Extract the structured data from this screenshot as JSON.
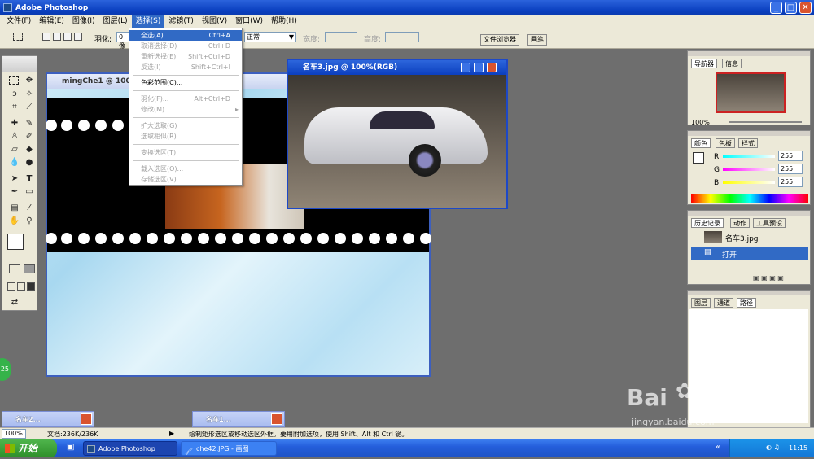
{
  "app": {
    "title": "Adobe Photoshop"
  },
  "menubar": [
    "文件(F)",
    "编辑(E)",
    "图像(I)",
    "图层(L)",
    "选择(S)",
    "滤镜(T)",
    "视图(V)",
    "窗口(W)",
    "帮助(H)"
  ],
  "options": {
    "feather_label": "羽化:",
    "feather_value": "0 像",
    "style_value": "正常",
    "width_label": "宽度:",
    "height_label": "高度:",
    "tab_file_browser": "文件浏览器",
    "tab_brushes": "画笔"
  },
  "select_menu": {
    "items": [
      {
        "label": "全选(A)",
        "shortcut": "Ctrl+A"
      },
      {
        "label": "取消选择(D)",
        "shortcut": "Ctrl+D"
      },
      {
        "label": "重新选择(E)",
        "shortcut": "Shift+Ctrl+D"
      },
      {
        "label": "反选(I)",
        "shortcut": "Shift+Ctrl+I"
      },
      {
        "label": "色彩范围(C)...",
        "shortcut": ""
      },
      {
        "label": "羽化(F)...",
        "shortcut": "Alt+Ctrl+D"
      },
      {
        "label": "修改(M)",
        "shortcut": "▸"
      },
      {
        "label": "扩大选取(G)",
        "shortcut": ""
      },
      {
        "label": "选取相似(R)",
        "shortcut": ""
      },
      {
        "label": "变换选区(T)",
        "shortcut": ""
      },
      {
        "label": "载入选区(O)...",
        "shortcut": ""
      },
      {
        "label": "存储选区(V)...",
        "shortcut": ""
      }
    ]
  },
  "doc_back": {
    "title": "mingChe1 @ 100%"
  },
  "doc_front": {
    "title": "名车3.jpg @ 100%(RGB)"
  },
  "navigator": {
    "tab1": "导航器",
    "tab2": "信息",
    "zoom": "100%"
  },
  "color": {
    "tab1": "颜色",
    "tab2": "色板",
    "tab3": "样式",
    "r_label": "R",
    "g_label": "G",
    "b_label": "B",
    "r": "255",
    "g": "255",
    "b": "255"
  },
  "history": {
    "tab1": "历史记录",
    "tab2": "动作",
    "tab3": "工具预设",
    "snapshot": "名车3.jpg",
    "step": "打开"
  },
  "layers": {
    "tab1": "图层",
    "tab2": "通道",
    "tab3": "路径"
  },
  "minimized": [
    {
      "title": "名车2..."
    },
    {
      "title": "名车1..."
    }
  ],
  "status": {
    "zoom": "100%",
    "doc": "文档:236K/236K",
    "hint": "绘制矩形选区或移动选区外框。要用附加选项，使用 Shift、Alt 和 Ctrl 键。"
  },
  "taskbar": {
    "start": "开始",
    "task1": "Adobe Photoshop",
    "task2": "che42.JPG - 画图",
    "time": "11:15"
  },
  "badge": "25",
  "watermark": {
    "brand": "Bai",
    "brand2": "经验",
    "url": "jingyan.baidu.com"
  }
}
